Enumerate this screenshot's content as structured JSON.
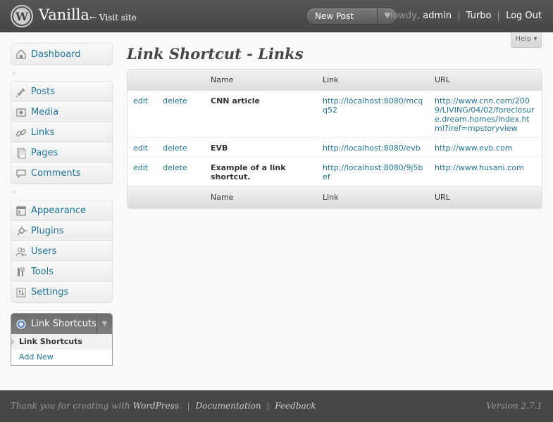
{
  "header": {
    "site_title": "Vanilla",
    "visit_site": "← Visit site",
    "favorite_action": "New Post",
    "howdy": "Howdy,",
    "username": "admin",
    "turbo": "Turbo",
    "logout": "Log Out"
  },
  "help": {
    "label": "Help ▾"
  },
  "sidebar": {
    "dashboard": "Dashboard",
    "content_items": [
      {
        "label": "Posts",
        "icon": "pin-icon"
      },
      {
        "label": "Media",
        "icon": "media-icon"
      },
      {
        "label": "Links",
        "icon": "link-icon"
      },
      {
        "label": "Pages",
        "icon": "pages-icon"
      },
      {
        "label": "Comments",
        "icon": "comments-icon"
      }
    ],
    "admin_items": [
      {
        "label": "Appearance",
        "icon": "appearance-icon"
      },
      {
        "label": "Plugins",
        "icon": "plugins-icon"
      },
      {
        "label": "Users",
        "icon": "users-icon"
      },
      {
        "label": "Tools",
        "icon": "tools-icon"
      },
      {
        "label": "Settings",
        "icon": "settings-icon"
      }
    ],
    "link_shortcuts": {
      "title": "Link Shortcuts",
      "submenu": [
        "Link Shortcuts",
        "Add New"
      ]
    }
  },
  "page": {
    "title": "Link Shortcut - Links"
  },
  "table": {
    "headers": [
      "",
      "Name",
      "Link",
      "URL"
    ],
    "rows": [
      {
        "edit": "edit",
        "delete": "delete",
        "name": "CNN article",
        "link": "http://localhost:8080/mcqq52",
        "url": "http://www.cnn.com/2009/LIVING/04/02/foreclosure.dream.homes/index.html?iref=mpstoryview"
      },
      {
        "edit": "edit",
        "delete": "delete",
        "name": "EVB",
        "link": "http://localhost:8080/evb",
        "url": "http://www.evb.com"
      },
      {
        "edit": "edit",
        "delete": "delete",
        "name": "Example of a link shortcut.",
        "link": "http://localhost:8080/9j5bef",
        "url": "http://www.husani.com"
      }
    ]
  },
  "footer": {
    "thanks": "Thank you for creating with",
    "wordpress": "WordPress",
    "documentation": "Documentation",
    "feedback": "Feedback",
    "version": "Version 2.7.1"
  },
  "colors": {
    "link": "#21759b",
    "header_bg": "#464646",
    "footer_bg": "#464646"
  }
}
